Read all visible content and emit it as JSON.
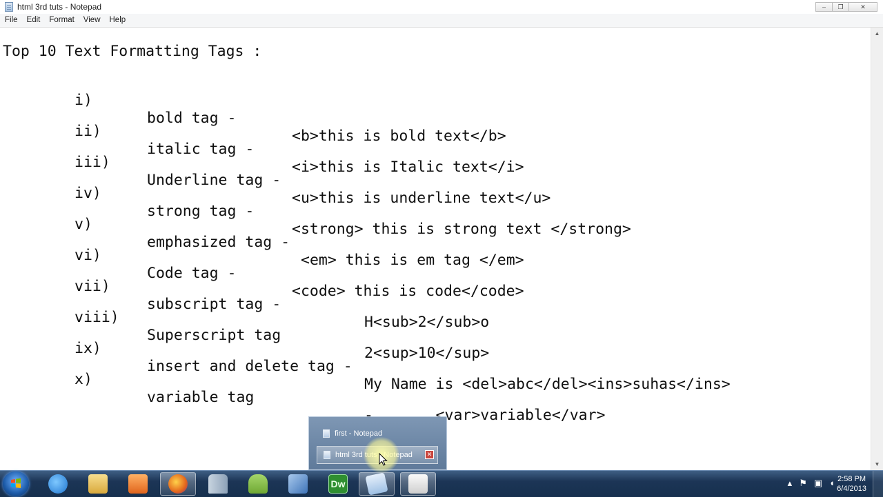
{
  "window": {
    "title": "html 3rd tuts - Notepad",
    "controls": {
      "minimize": "–",
      "maximize": "❐",
      "close": "✕"
    }
  },
  "menu": [
    "File",
    "Edit",
    "Format",
    "View",
    "Help"
  ],
  "editor": {
    "heading": "Top 10 Text Formatting Tags :",
    "lines": [
      {
        "num": "i)",
        "name": "bold tag -",
        "code": "<b>this is bold text</b>"
      },
      {
        "num": "ii)",
        "name": "italic tag -",
        "code": "<i>this is Italic text</i>"
      },
      {
        "num": "iii)",
        "name": "Underline tag -",
        "code": "<u>this is underline text</u>"
      },
      {
        "num": "iv)",
        "name": "strong tag -",
        "code": "<strong> this is strong text </strong>"
      },
      {
        "num": "v)",
        "name": "emphasized tag -",
        "code": "<em> this is em tag </em>"
      },
      {
        "num": "vi)",
        "name": "Code tag -",
        "code": "<code> this is code</code>"
      },
      {
        "num": "vii)",
        "name": "subscript tag -",
        "code": "H<sub>2</sub>o"
      },
      {
        "num": "viii)",
        "name": "Superscript tag",
        "code": "2<sup>10</sup>"
      },
      {
        "num": "ix)",
        "name": "insert and delete tag -",
        "code": "My Name is <del>abc</del><ins>suhas</ins>"
      },
      {
        "num": "x)",
        "name": "variable tag",
        "code": "-       <var>variable</var>"
      }
    ]
  },
  "popup": {
    "items": [
      {
        "label": "first - Notepad"
      },
      {
        "label": "html 3rd tuts - Notepad"
      }
    ],
    "close_glyph": "✕"
  },
  "taskbar": {
    "apps": [
      {
        "icon": "internet-explorer-icon",
        "color": "#2d8be0"
      },
      {
        "icon": "file-explorer-icon",
        "color": "#e8c56a"
      },
      {
        "icon": "media-player-icon",
        "color": "#f08a2c"
      },
      {
        "icon": "firefox-icon",
        "color": "#e3661c"
      },
      {
        "icon": "database-installer-icon",
        "color": "#9fb4c8"
      },
      {
        "icon": "android-emulator-icon",
        "color": "#8cc34a"
      },
      {
        "icon": "virtualbox-icon",
        "color": "#6a9bd4"
      },
      {
        "icon": "dreamweaver-icon",
        "color": "#35a23a",
        "text": "Dw"
      },
      {
        "icon": "notepad-icon",
        "color": "#b9d4ec"
      },
      {
        "icon": "notepad-group-icon",
        "color": "#e8e8e8"
      }
    ],
    "clock": {
      "time": "2:58 PM",
      "date": "6/4/2013"
    }
  }
}
